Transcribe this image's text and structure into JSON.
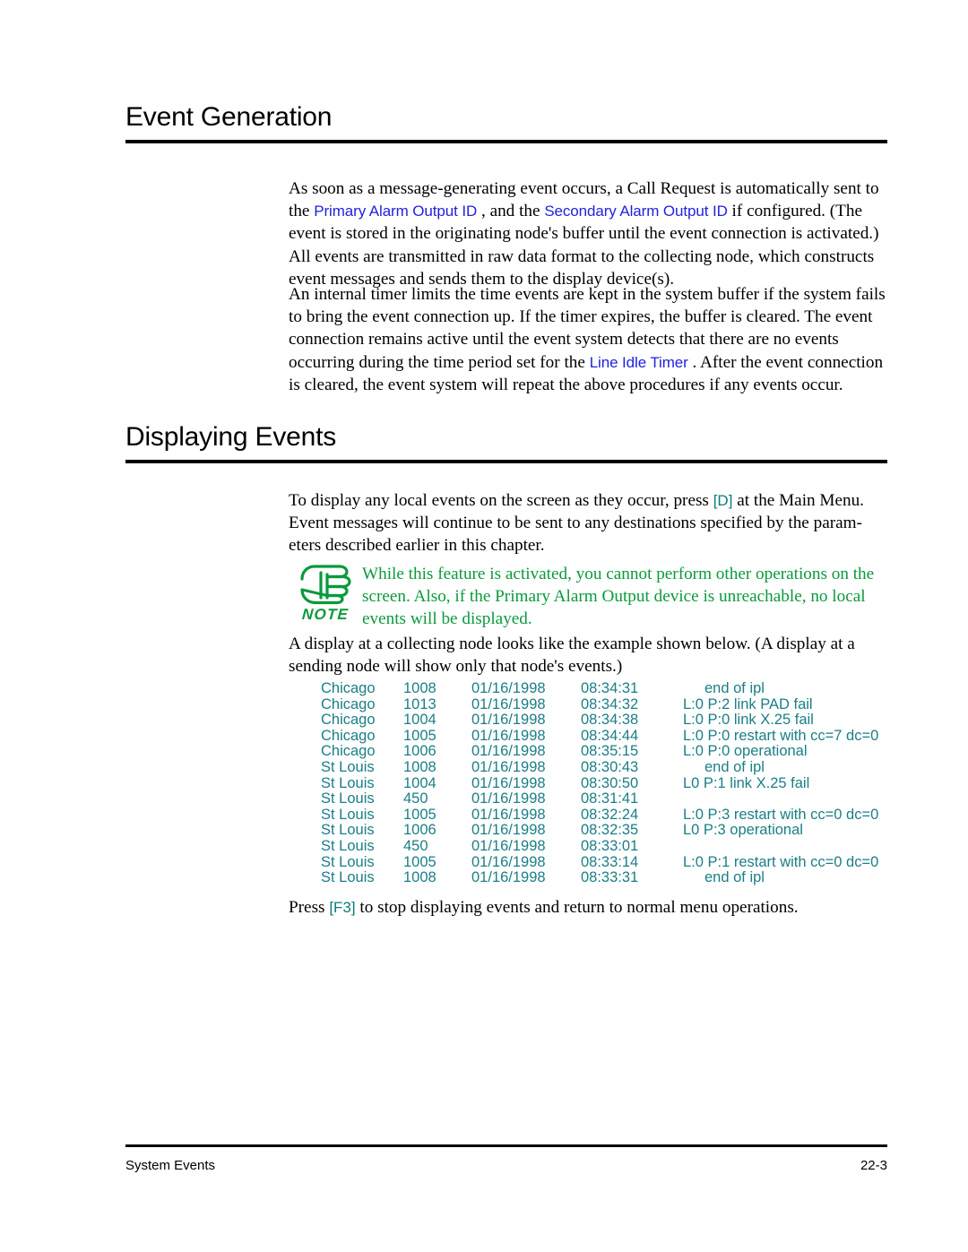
{
  "document": {
    "sections": [
      {
        "heading": "Event Generation",
        "paragraphs": [
          {
            "runs": [
              {
                "type": "text",
                "text": "As soon as a message-generating event occurs, a Call Request is automatically sent to the "
              },
              {
                "type": "link",
                "text": "Primary Alarm Output ID"
              },
              {
                "type": "text",
                "text": " , and the "
              },
              {
                "type": "link",
                "text": "Secondary Alarm Output ID"
              },
              {
                "type": "text",
                "text": " if configured. (The event is stored in the originating node's buffer until the event connection is activated.) All events are transmitted in raw data format to the collecting node, which constructs event messages and sends them to the display device(s)."
              }
            ]
          },
          {
            "runs": [
              {
                "type": "text",
                "text": "An internal timer limits the time events are kept in the system buffer if the system fails to bring the event connection up. If the timer expires, the buffer is cleared. The event connection remains active until the event system detects that there are no events occurring during the time period set for the "
              },
              {
                "type": "link",
                "text": "Line Idle Timer"
              },
              {
                "type": "text",
                "text": " . After the event connection is cleared, the event system will repeat the above procedures if any events occur."
              }
            ]
          }
        ]
      },
      {
        "heading": "Displaying Events",
        "paragraphs": [
          {
            "runs": [
              {
                "type": "text",
                "text": "To display any local events on the screen as they occur, press "
              },
              {
                "type": "keycap",
                "text": "[D]"
              },
              {
                "type": "text",
                "text": " at the Main Menu. Event messages will continue to be sent to any destinations specified by the param-eters described earlier in this chapter."
              }
            ]
          }
        ]
      }
    ]
  },
  "note": {
    "icon": "pointing-hand-icon",
    "label": "NOTE",
    "text": "While this feature is activated, you cannot perform other operations on the screen. Also, if the Primary Alarm Output device is unreachable, no local events will be displayed.",
    "color": "#0A9A3C"
  },
  "example_intro": {
    "runs": [
      {
        "type": "text",
        "text": "A display at a collecting node looks like the example shown below. (A display at a sending node will show only that node's events.)"
      }
    ]
  },
  "event_log": {
    "color": "#1A7F86",
    "columns": [
      "node",
      "code",
      "date",
      "time",
      "message"
    ],
    "rows": [
      {
        "node": "Chicago",
        "code": "1008",
        "date": "01/16/1998",
        "time": "08:34:31",
        "message": "end of ipl",
        "indent": true
      },
      {
        "node": "Chicago",
        "code": "1013",
        "date": "01/16/1998",
        "time": "08:34:32",
        "message": "L:0 P:2 link PAD fail",
        "indent": false
      },
      {
        "node": "Chicago",
        "code": "1004",
        "date": "01/16/1998",
        "time": "08:34:38",
        "message": "L:0 P:0 link X.25 fail",
        "indent": false
      },
      {
        "node": "Chicago",
        "code": "1005",
        "date": "01/16/1998",
        "time": "08:34:44",
        "message": "L:0 P:0 restart with cc=7 dc=0",
        "indent": false
      },
      {
        "node": "Chicago",
        "code": "1006",
        "date": "01/16/1998",
        "time": "08:35:15",
        "message": "L:0 P:0 operational",
        "indent": false
      },
      {
        "node": "St Louis",
        "code": "1008",
        "date": "01/16/1998",
        "time": "08:30:43",
        "message": "end of ipl",
        "indent": true
      },
      {
        "node": "St Louis",
        "code": "1004",
        "date": "01/16/1998",
        "time": "08:30:50",
        "message": "L0 P:1 link X.25 fail",
        "indent": false
      },
      {
        "node": "St Louis",
        "code": "450",
        "date": "01/16/1998",
        "time": "08:31:41",
        "message": "",
        "indent": false
      },
      {
        "node": "St Louis",
        "code": "1005",
        "date": "01/16/1998",
        "time": "08:32:24",
        "message": "L:0 P:3 restart with cc=0 dc=0",
        "indent": false
      },
      {
        "node": "St Louis",
        "code": "1006",
        "date": "01/16/1998",
        "time": "08:32:35",
        "message": "L0 P:3 operational",
        "indent": false
      },
      {
        "node": "St Louis",
        "code": "450",
        "date": "01/16/1998",
        "time": "08:33:01",
        "message": "",
        "indent": false
      },
      {
        "node": "St Louis",
        "code": "1005",
        "date": "01/16/1998",
        "time": "08:33:14",
        "message": "L:0 P:1 restart with cc=0 dc=0",
        "indent": false
      },
      {
        "node": "St Louis",
        "code": "1008",
        "date": "01/16/1998",
        "time": "08:33:31",
        "message": "end of ipl",
        "indent": true
      }
    ]
  },
  "closing": {
    "runs": [
      {
        "type": "text",
        "text": "Press "
      },
      {
        "type": "keycap",
        "text": "[F3]"
      },
      {
        "type": "text",
        "text": " to stop displaying events and return to normal menu operations."
      }
    ]
  },
  "footer": {
    "left": "System Events",
    "right": "22-3"
  }
}
